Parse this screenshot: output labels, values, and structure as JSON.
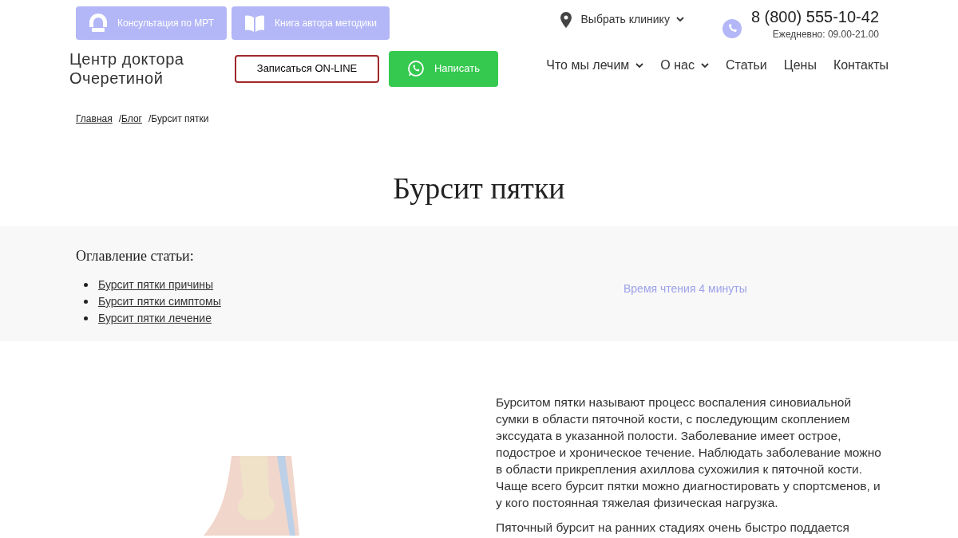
{
  "top_buttons": [
    {
      "kind": "mri",
      "label": "Консультация по МРТ"
    },
    {
      "kind": "book",
      "label": "Книга автора методики"
    }
  ],
  "logo": {
    "line1": "Центр доктора",
    "line2": "Очеретиной"
  },
  "online_button": "Записаться ON-LINE",
  "write_button": "Написать",
  "clinic_select": "Выбрать клинику",
  "phone": {
    "number": "8 (800) 555-10-42",
    "hours": "Ежедневно: 09.00-21.00"
  },
  "nav": [
    {
      "label": "Что мы лечим",
      "dropdown": true
    },
    {
      "label": "О нас",
      "dropdown": true
    },
    {
      "label": "Статьи",
      "dropdown": false
    },
    {
      "label": "Цены",
      "dropdown": false
    },
    {
      "label": "Контакты",
      "dropdown": false
    }
  ],
  "breadcrumb": [
    {
      "label": "Главная",
      "link": true
    },
    {
      "separator": "/",
      "label": "Блог",
      "link": true
    },
    {
      "separator": "/",
      "label": "Бурсит пятки",
      "link": false
    }
  ],
  "page_title": "Бурсит пятки",
  "toc": {
    "title": "Оглавление статьи:",
    "items": [
      "Бурсит пятки причины",
      "Бурсит пятки симптомы",
      "Бурсит пятки лечение"
    ],
    "reading_time": "Время чтения 4 минуты"
  },
  "article": {
    "paragraphs": [
      "Бурситом пятки называют процесс воспаления синовиальной сумки в области пяточной кости, с последующим скоплением экссудата в указанной полости. Заболевание имеет острое, подострое и хроническое течение. Наблюдать заболевание можно в области прикрепления ахиллова сухожилия к пяточной кости. Чаще всего бурсит пятки можно диагностировать у спортсменов, и у кого постоянная тяжелая физическая нагрузка.",
      "Пяточный бурсит на ранних стадиях очень быстро поддается"
    ]
  }
}
